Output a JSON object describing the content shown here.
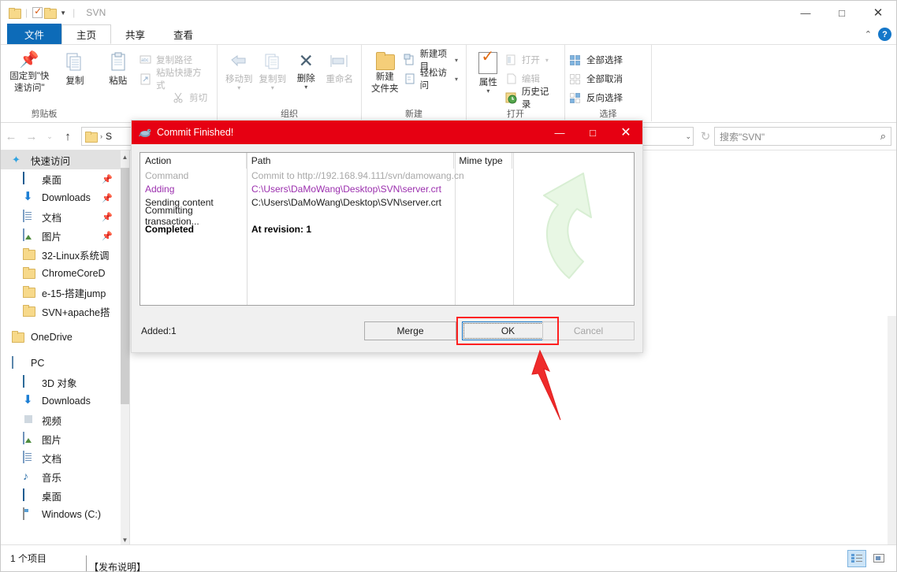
{
  "window": {
    "title": "SVN",
    "quick_access": [
      "folder-icon",
      "properties-icon",
      "folder-icon"
    ],
    "controls": {
      "minimize": "—",
      "maximize": "□",
      "close": "✕"
    },
    "help": "?",
    "collapse_ribbon": "⌃"
  },
  "tabs": [
    {
      "label": "文件",
      "name": "tab-file",
      "state": "file"
    },
    {
      "label": "主页",
      "name": "tab-home",
      "state": "active"
    },
    {
      "label": "共享",
      "name": "tab-share",
      "state": "normal"
    },
    {
      "label": "查看",
      "name": "tab-view",
      "state": "normal"
    }
  ],
  "ribbon": {
    "groups": [
      {
        "label": "剪贴板",
        "big": [
          {
            "label_line1": "固定到\"快",
            "label_line2": "速访问\"",
            "icon": "pin-icon",
            "disabled": false
          },
          {
            "label_line1": "复制",
            "label_line2": "",
            "icon": "copy-icon",
            "disabled": false
          },
          {
            "label_line1": "粘贴",
            "label_line2": "",
            "icon": "paste-icon",
            "disabled": false
          }
        ],
        "small": [
          {
            "label": "复制路径",
            "icon": "copy-path-icon",
            "disabled": true
          },
          {
            "label": "粘贴快捷方式",
            "icon": "paste-shortcut-icon",
            "disabled": true
          },
          {
            "label": "剪切",
            "icon": "scissors-icon",
            "disabled": true
          }
        ]
      },
      {
        "label": "组织",
        "big": [
          {
            "label_line1": "移动到",
            "label_line2": "",
            "icon": "move-to-icon",
            "disabled": true,
            "caret": true
          },
          {
            "label_line1": "复制到",
            "label_line2": "",
            "icon": "copy-to-icon",
            "disabled": true,
            "caret": true
          },
          {
            "label_line1": "删除",
            "label_line2": "",
            "icon": "delete-x-icon",
            "disabled": false,
            "caret": true
          },
          {
            "label_line1": "重命名",
            "label_line2": "",
            "icon": "rename-icon",
            "disabled": true
          }
        ],
        "small": []
      },
      {
        "label": "新建",
        "big": [
          {
            "label_line1": "新建",
            "label_line2": "文件夹",
            "icon": "new-folder-icon",
            "disabled": false
          }
        ],
        "small": [
          {
            "label": "新建项目",
            "icon": "new-item-icon",
            "disabled": false,
            "caret": true
          },
          {
            "label": "轻松访问",
            "icon": "easy-access-icon",
            "disabled": false,
            "caret": true
          }
        ]
      },
      {
        "label": "打开",
        "big": [
          {
            "label_line1": "属性",
            "label_line2": "",
            "icon": "properties-icon",
            "disabled": false,
            "caret": true
          }
        ],
        "small": [
          {
            "label": "打开",
            "icon": "open-icon",
            "disabled": true,
            "caret": true
          },
          {
            "label": "编辑",
            "icon": "edit-icon",
            "disabled": true
          },
          {
            "label": "历史记录",
            "icon": "history-icon",
            "disabled": false
          }
        ]
      },
      {
        "label": "选择",
        "big": [],
        "small": [
          {
            "label": "全部选择",
            "icon": "select-all-icon",
            "disabled": false
          },
          {
            "label": "全部取消",
            "icon": "select-none-icon",
            "disabled": false
          },
          {
            "label": "反向选择",
            "icon": "invert-selection-icon",
            "disabled": false
          }
        ]
      }
    ]
  },
  "address": {
    "back": "←",
    "forward": "→",
    "recent": "⌄",
    "up": "↑",
    "crumb_icon": "folder-icon",
    "crumb_text": "S",
    "dropdown": "⌄",
    "refresh": "↻"
  },
  "search": {
    "placeholder": "搜索\"SVN\"",
    "icon": "search-icon"
  },
  "nav_pane": {
    "items": [
      {
        "label": "快速访问",
        "icon": "star-icon",
        "indent": 0,
        "selected": true,
        "pinned": false
      },
      {
        "label": "桌面",
        "icon": "desktop-icon",
        "indent": 1,
        "selected": false,
        "pinned": true
      },
      {
        "label": "Downloads",
        "icon": "downloads-icon",
        "indent": 1,
        "selected": false,
        "pinned": true
      },
      {
        "label": "文档",
        "icon": "documents-icon",
        "indent": 1,
        "selected": false,
        "pinned": true
      },
      {
        "label": "图片",
        "icon": "pictures-icon",
        "indent": 1,
        "selected": false,
        "pinned": true
      },
      {
        "label": "32-Linux系统调",
        "icon": "folder-icon",
        "indent": 1,
        "selected": false,
        "pinned": false
      },
      {
        "label": "ChromeCoreD",
        "icon": "folder-icon",
        "indent": 1,
        "selected": false,
        "pinned": false
      },
      {
        "label": "e-15-搭建jump",
        "icon": "folder-icon",
        "indent": 1,
        "selected": false,
        "pinned": false
      },
      {
        "label": "SVN+apache搭",
        "icon": "folder-icon",
        "indent": 1,
        "selected": false,
        "pinned": false
      },
      {
        "label": "OneDrive",
        "icon": "folder-icon",
        "indent": 0,
        "selected": false,
        "pinned": false
      },
      {
        "label": "PC",
        "icon": "pc-icon",
        "indent": 0,
        "selected": false,
        "pinned": false
      },
      {
        "label": "3D 对象",
        "icon": "3d-objects-icon",
        "indent": 1,
        "selected": false,
        "pinned": false
      },
      {
        "label": "Downloads",
        "icon": "downloads-icon",
        "indent": 1,
        "selected": false,
        "pinned": false
      },
      {
        "label": "视频",
        "icon": "videos-icon",
        "indent": 1,
        "selected": false,
        "pinned": false
      },
      {
        "label": "图片",
        "icon": "pictures-icon",
        "indent": 1,
        "selected": false,
        "pinned": false
      },
      {
        "label": "文档",
        "icon": "documents-icon",
        "indent": 1,
        "selected": false,
        "pinned": false
      },
      {
        "label": "音乐",
        "icon": "music-icon",
        "indent": 1,
        "selected": false,
        "pinned": false
      },
      {
        "label": "桌面",
        "icon": "desktop-icon",
        "indent": 1,
        "selected": false,
        "pinned": false
      },
      {
        "label": "Windows (C:)",
        "icon": "drive-icon",
        "indent": 1,
        "selected": false,
        "pinned": false
      }
    ]
  },
  "status": {
    "item_count": "1 个项目",
    "view_details": "details-view-icon",
    "view_large": "large-icons-view-icon",
    "bottom_caption": "【发布说明】"
  },
  "dialog": {
    "title": "Commit Finished!",
    "icon": "tortoisesvn-icon",
    "controls": {
      "minimize": "—",
      "maximize": "□",
      "close": "✕"
    },
    "columns": [
      "Action",
      "Path",
      "Mime type",
      ""
    ],
    "rows": [
      {
        "action": "Command",
        "path": "Commit to http://192.168.94.111/svn/damowang.cn",
        "mime": "",
        "style": "dim"
      },
      {
        "action": "Adding",
        "path": "C:\\Users\\DaMoWang\\Desktop\\SVN\\server.crt",
        "mime": "",
        "style": "add"
      },
      {
        "action": "Sending content",
        "path": "C:\\Users\\DaMoWang\\Desktop\\SVN\\server.crt",
        "mime": "",
        "style": "norm"
      },
      {
        "action": "Committing transaction...",
        "path": "",
        "mime": "",
        "style": "norm"
      },
      {
        "action": "Completed",
        "path": "At revision: 1",
        "mime": "",
        "style": "done"
      }
    ],
    "summary": "Added:1",
    "buttons": {
      "merge": "Merge",
      "ok": "OK",
      "cancel": "Cancel"
    },
    "watermark": "green-curved-arrow-icon"
  },
  "annotation": {
    "arrow": "red-arrow-pointing-to-ok"
  },
  "colors": {
    "dialog_title_bg": "#e60012",
    "file_tab_bg": "#0d6bb8",
    "adding_row": "#9b2fae",
    "highlight_box": "#ff2020",
    "focus_border": "#1573c4",
    "watermark_green": "#c8ecc0"
  }
}
